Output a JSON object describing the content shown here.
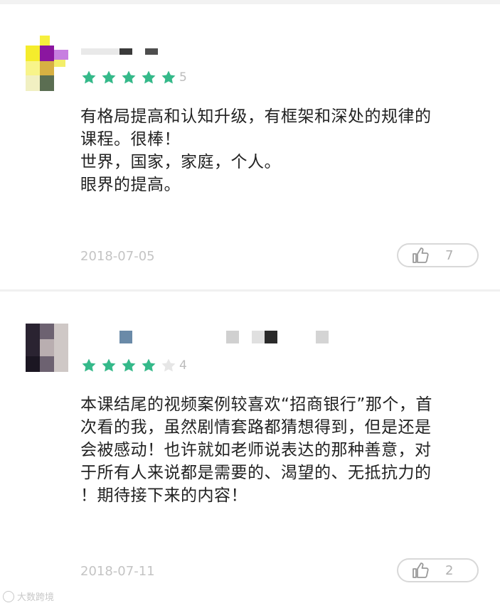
{
  "reviews": [
    {
      "rating": 5,
      "score_label": "5",
      "lines": [
        "有格局提高和认知升级，有框架和深处的规律的",
        "课程。很棒！",
        "世界，国家，家庭，个人。",
        "眼界的提高。"
      ],
      "date": "2018-07-05",
      "likes": "7"
    },
    {
      "rating": 4,
      "score_label": "4",
      "lines": [
        "本课结尾的视频案例较喜欢“招商银行”那个，首",
        "次看的我，虽然剧情套路都猜想得到，但是还是",
        "会被感动！也许就如老师说表达的那种善意，对",
        "于所有人来说都是需要的、渴望的、无抵抗力的",
        "！期待接下来的内容！"
      ],
      "date": "2018-07-11",
      "likes": "2"
    }
  ],
  "colors": {
    "star_filled": "#35b98a",
    "star_empty": "#e6e6e6"
  },
  "icons": {
    "like": "thumbs-up-icon",
    "star": "star-icon"
  },
  "watermark": {
    "text": "大数跨境"
  }
}
